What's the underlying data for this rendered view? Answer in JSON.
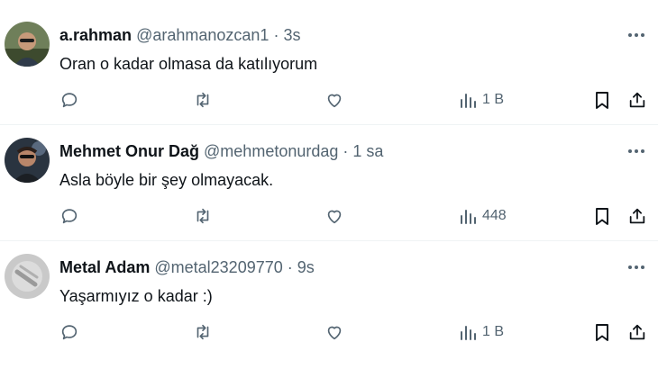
{
  "tweets": [
    {
      "display_name": "a.rahman",
      "handle": "@arahmanozcan1",
      "separator": "·",
      "time": "3s",
      "text": "Oran o kadar olmasa da katılıyorum",
      "views": "1 B",
      "avatar_icon": "user-photo-avatar"
    },
    {
      "display_name": "Mehmet Onur Dağ",
      "handle": "@mehmetonurdag",
      "separator": "·",
      "time": "1 sa",
      "text": "Asla böyle bir şey olmayacak.",
      "views": "448",
      "avatar_icon": "user-photo-avatar"
    },
    {
      "display_name": "Metal Adam",
      "handle": "@metal23209770",
      "separator": "·",
      "time": "9s",
      "text": "Yaşarmıyız o kadar :)",
      "views": "1 B",
      "avatar_icon": "gray-object-avatar"
    }
  ],
  "colors": {
    "text": "#0f1419",
    "secondary": "#536471",
    "divider": "#eff3f4"
  },
  "icons": [
    "more-icon",
    "reply-icon",
    "retweet-icon",
    "like-icon",
    "views-icon",
    "bookmark-icon",
    "share-icon"
  ]
}
